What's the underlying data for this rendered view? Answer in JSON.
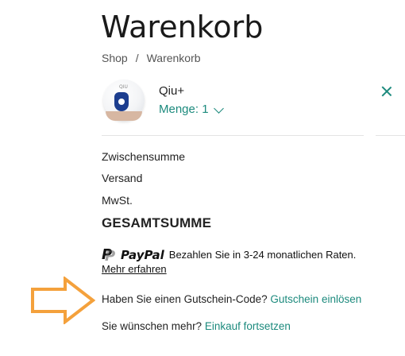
{
  "page": {
    "title": "Warenkorb"
  },
  "breadcrumb": {
    "home": "Shop",
    "separator": "/",
    "current": "Warenkorb"
  },
  "cart": {
    "item": {
      "name": "Qiu+",
      "quantity_label": "Menge: 1",
      "image_logo": "QIU"
    }
  },
  "summary": {
    "subtotal_label": "Zwischensumme",
    "shipping_label": "Versand",
    "tax_label": "MwSt.",
    "total_label": "GESAMTSUMME"
  },
  "paypal": {
    "brand": "PayPal",
    "text": "Bezahlen Sie in 3-24 monatlichen Raten.",
    "learn_more": "Mehr erfahren"
  },
  "coupon": {
    "question": "Haben Sie einen Gutschein-Code?",
    "link": "Gutschein einlösen"
  },
  "continue": {
    "question": "Sie wünschen mehr?",
    "link": "Einkauf fortsetzen"
  },
  "colors": {
    "accent": "#1c8a7d",
    "arrow": "#f4a13c",
    "text": "#222222",
    "divider": "#e4e4e4"
  }
}
